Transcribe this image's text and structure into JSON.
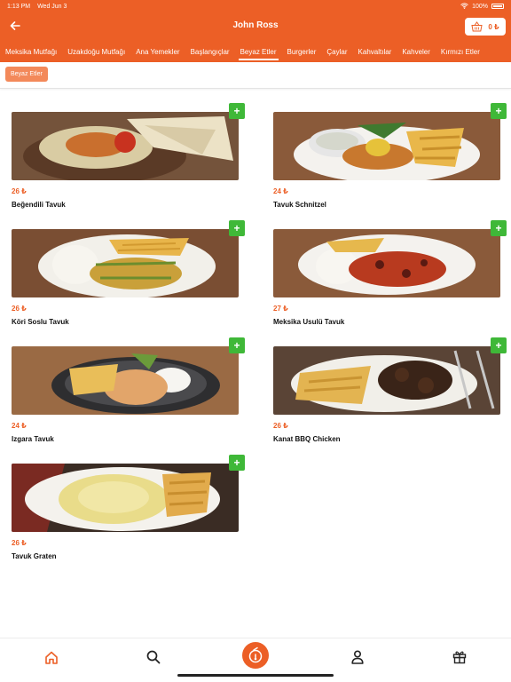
{
  "status": {
    "time": "1:13 PM",
    "date": "Wed Jun 3",
    "battery": "100%",
    "wifi_icon": "wifi-icon",
    "battery_icon": "battery-icon"
  },
  "header": {
    "title": "John Ross",
    "back_icon": "arrow-left-icon",
    "cart_icon": "basket-icon",
    "cart_total": "0 ₺"
  },
  "tabs": [
    {
      "label": "Meksika Mutfağı",
      "active": false
    },
    {
      "label": "Uzakdoğu Mutfağı",
      "active": false
    },
    {
      "label": "Ana Yemekler",
      "active": false
    },
    {
      "label": "Başlangıçlar",
      "active": false
    },
    {
      "label": "Beyaz Etler",
      "active": true
    },
    {
      "label": "Burgerler",
      "active": false
    },
    {
      "label": "Çaylar",
      "active": false
    },
    {
      "label": "Kahvaltılar",
      "active": false
    },
    {
      "label": "Kahveler",
      "active": false
    },
    {
      "label": "Kırmızı Etler",
      "active": false
    }
  ],
  "subcategory": {
    "label": "Beyaz Etler"
  },
  "products": [
    {
      "name": "Beğendili Tavuk",
      "price": "26 ₺"
    },
    {
      "name": "Tavuk Schnitzel",
      "price": "24 ₺"
    },
    {
      "name": "Köri Soslu Tavuk",
      "price": "26 ₺"
    },
    {
      "name": "Meksika Usulü Tavuk",
      "price": "27 ₺"
    },
    {
      "name": "Izgara Tavuk",
      "price": "24 ₺"
    },
    {
      "name": "Kanat BBQ Chicken",
      "price": "26 ₺"
    },
    {
      "name": "Tavuk Graten",
      "price": "26 ₺"
    }
  ],
  "add_button": {
    "label": "+"
  },
  "bottom_nav": [
    {
      "icon": "home-icon",
      "active": true
    },
    {
      "icon": "search-icon",
      "active": false
    },
    {
      "icon": "restaurant-logo-icon",
      "active": false
    },
    {
      "icon": "user-icon",
      "active": false
    },
    {
      "icon": "gift-icon",
      "active": false
    }
  ],
  "colors": {
    "brand": "#ec5f26",
    "add": "#3fb838",
    "chip": "#f3895a"
  }
}
